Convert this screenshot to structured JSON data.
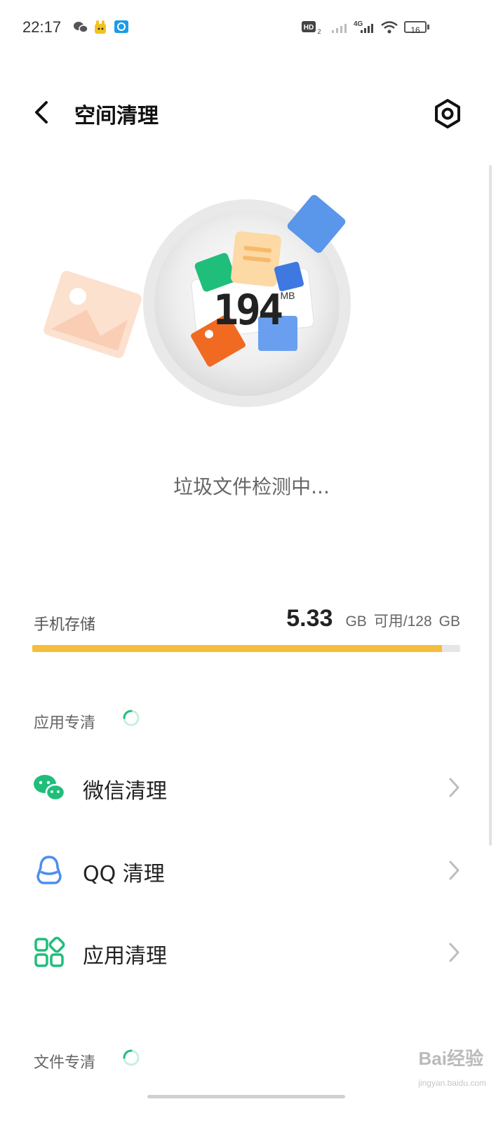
{
  "status_bar": {
    "time": "22:17",
    "icons": [
      "wechat-icon",
      "mascot-app-icon",
      "browser-app-icon",
      "hd-voice-icon",
      "signal-1-icon",
      "signal-4g-icon",
      "wifi-icon",
      "battery-icon"
    ],
    "hd_label": "HD",
    "hd_sub": "2",
    "network_label": "4G",
    "battery_level": "16"
  },
  "header": {
    "title": "空间清理",
    "back_icon": "back-arrow-icon",
    "settings_icon": "settings-icon"
  },
  "hero": {
    "junk_size": "194",
    "junk_unit": "MB",
    "scan_status": "垃圾文件检测中..."
  },
  "storage": {
    "label": "手机存储",
    "available": "5.33",
    "available_unit": "GB",
    "separator_text": "可用/128",
    "total_unit": "GB",
    "used_fraction": 0.958,
    "bar_color": "#f5bd3b"
  },
  "app_clean": {
    "title": "应用专清",
    "items": [
      {
        "label": "微信清理",
        "icon": "wechat-icon",
        "color": "#1fbe7a"
      },
      {
        "label": "QQ 清理",
        "icon": "qq-icon",
        "color": "#4a8ef0"
      },
      {
        "label": "应用清理",
        "icon": "apps-grid-icon",
        "color": "#1fbe7a"
      }
    ]
  },
  "file_clean": {
    "title": "文件专清"
  },
  "watermark": {
    "text": "Bai经验",
    "sub": "jingyan.baidu.com"
  },
  "colors": {
    "accent_green": "#1fbe7a",
    "accent_blue": "#4a8ef0",
    "storage_bar": "#f5bd3b"
  }
}
